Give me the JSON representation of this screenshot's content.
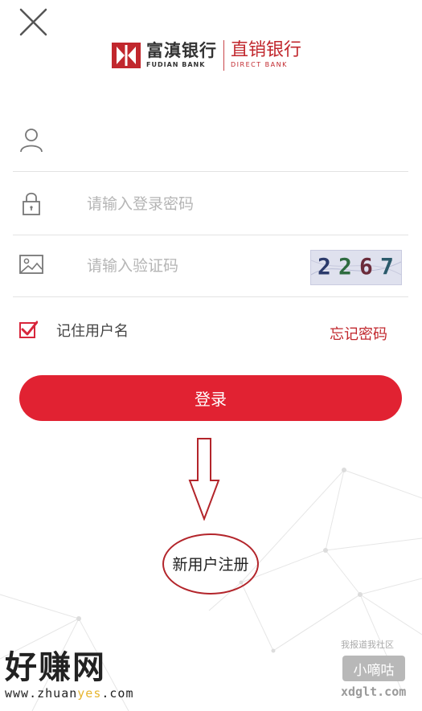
{
  "header": {
    "close_icon": "close-icon"
  },
  "logo": {
    "bank_name_cn": "富滇银行",
    "bank_name_en": "FUDIAN BANK",
    "direct_cn": "直销银行",
    "direct_en": "DIRECT BANK",
    "brand_color": "#c1272d"
  },
  "form": {
    "username": {
      "icon": "user-icon",
      "value": "",
      "placeholder": ""
    },
    "password": {
      "icon": "lock-icon",
      "value": "",
      "placeholder": "请输入登录密码"
    },
    "captcha": {
      "icon": "image-icon",
      "value": "",
      "placeholder": "请输入验证码",
      "code_chars": [
        "2",
        "2",
        "6",
        "7"
      ]
    },
    "remember_label": "记住用户名",
    "remember_checked": true,
    "forgot_label": "忘记密码",
    "login_label": "登录",
    "accent_color": "#e12232"
  },
  "register": {
    "label": "新用户注册"
  },
  "watermarks": {
    "left_big": "好赚网",
    "left_url_prefix": "www.zhuan",
    "left_url_highlight": "yes",
    "left_url_suffix": ".com",
    "right_top": "我报道我社区",
    "right_mid": "小嘀咕",
    "right_bottom": "xdglt.com"
  }
}
